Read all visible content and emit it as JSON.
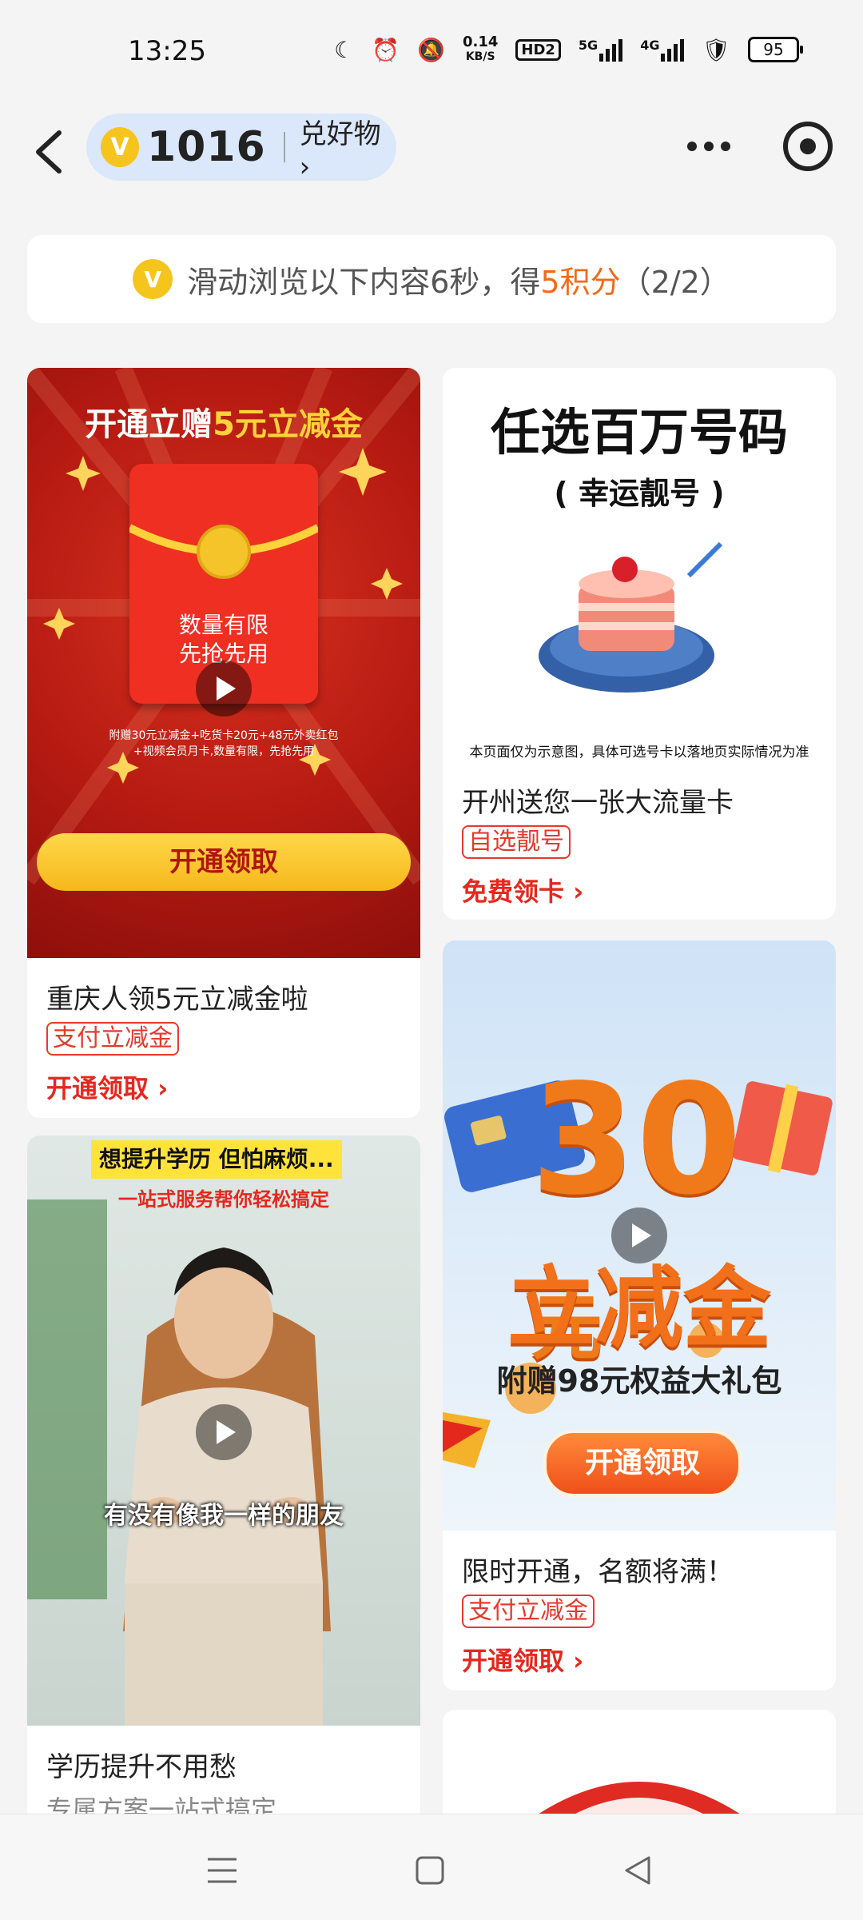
{
  "status": {
    "time": "13:25",
    "speed_top": "0.14",
    "speed_bottom": "KB/S",
    "hd": "HD2",
    "net1": "5G",
    "net2": "4G",
    "battery": "95"
  },
  "nav": {
    "points": "1016",
    "link": "兑好物 ›"
  },
  "task": {
    "prefix": "滑动浏览以下内容6秒，得",
    "reward": "5积分",
    "suffix": "（2/2）"
  },
  "cards": {
    "c1": {
      "banner_headline_a": "开通立赠",
      "banner_headline_b": "5元立减金",
      "envelope_text1": "数量有限",
      "envelope_text2": "先抢先用",
      "fine_print1": "附赠30元立减金+吃货卡20元+48元外卖红包",
      "fine_print2": "+视频会员月卡,数量有限，先抢先用",
      "banner_button": "开通领取",
      "title": "重庆人领5元立减金啦",
      "tag": "支付立减金",
      "cta": "开通领取 ›"
    },
    "c2": {
      "banner_headline": "任选百万号码",
      "banner_sub": "( 幸运靓号 )",
      "banner_note": "本页面仅为示意图，具体可选号卡以落地页实际情况为准",
      "title": "开州送您一张大流量卡",
      "tag": "自选靓号",
      "cta": "免费领卡 ›"
    },
    "c3": {
      "banner_big_num": "30",
      "banner_unit": "元",
      "banner_headline": "立减金",
      "banner_sub": "附赠98元权益大礼包",
      "banner_button": "开通领取",
      "title": "限时开通，名额将满！",
      "tag": "支付立减金",
      "cta": "开通领取 ›"
    },
    "c4": {
      "banner_caption_top": "想提升学历 但怕麻烦...",
      "banner_caption_mid": "一站式服务帮你轻松搞定",
      "banner_subtitle": "有没有像我一样的朋友",
      "title": "学历提升不用愁",
      "sub": "专属方案一站式搞定"
    }
  },
  "colors": {
    "accent": "#f26a1a",
    "red": "#e5281e",
    "pill_bg": "#dbe7fb",
    "coin": "#f6c51d"
  }
}
